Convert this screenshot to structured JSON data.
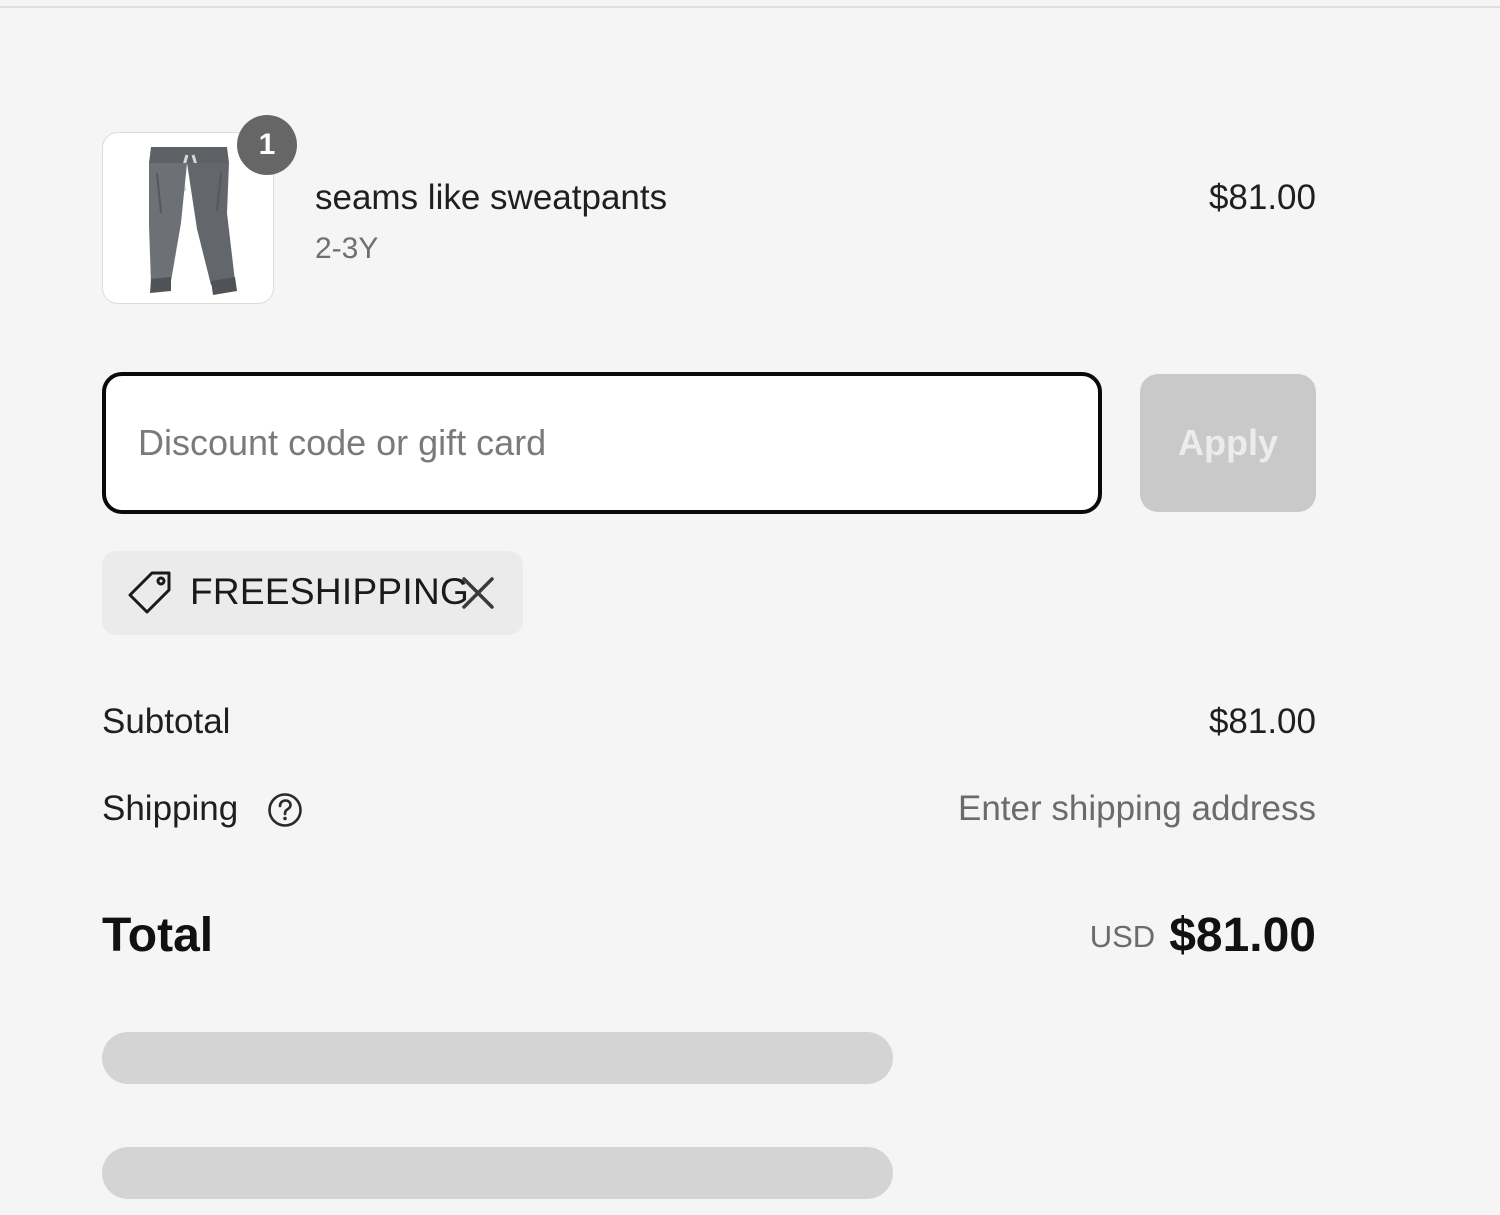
{
  "line_item": {
    "quantity": "1",
    "name": "seams like sweatpants",
    "variant": "2-3Y",
    "price": "$81.00",
    "image_icon": "sweatpants-image"
  },
  "discount": {
    "placeholder": "Discount code or gift card",
    "value": "",
    "apply_label": "Apply",
    "apply_enabled": false
  },
  "applied_code": {
    "code": "FREESHIPPING",
    "icon": "tag-icon",
    "remove_icon": "close-icon"
  },
  "totals": {
    "subtotal_label": "Subtotal",
    "subtotal_value": "$81.00",
    "shipping_label": "Shipping",
    "shipping_help_icon": "help-circle-icon",
    "shipping_value": "Enter shipping address",
    "total_label": "Total",
    "total_currency": "USD",
    "total_value": "$81.00"
  },
  "colors": {
    "background": "#f5f5f5",
    "badge": "#666666",
    "apply_disabled": "#c9c9c9",
    "chip": "#ebebeb",
    "skeleton": "#d4d4d4"
  }
}
